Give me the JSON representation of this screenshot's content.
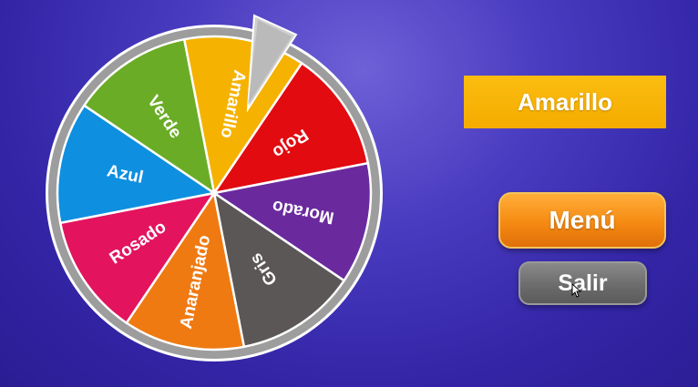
{
  "wheel": {
    "rotation_deg": -11,
    "segments": [
      {
        "label": "Amarillo",
        "color": "#f5b200"
      },
      {
        "label": "Rojo",
        "color": "#e10b10"
      },
      {
        "label": "Morado",
        "color": "#6a2a9e"
      },
      {
        "label": "Gris",
        "color": "#5b5756"
      },
      {
        "label": "Anaranjado",
        "color": "#ef7a12"
      },
      {
        "label": "Rosado",
        "color": "#e3135e"
      },
      {
        "label": "Azul",
        "color": "#0e8fe0"
      },
      {
        "label": "Verde",
        "color": "#6aac26"
      }
    ],
    "rim_color": "#9d9d9d",
    "pointer_color": "#cfcfcf"
  },
  "result": {
    "text": "Amarillo"
  },
  "buttons": {
    "menu_label": "Menú",
    "exit_label": "Salir"
  }
}
